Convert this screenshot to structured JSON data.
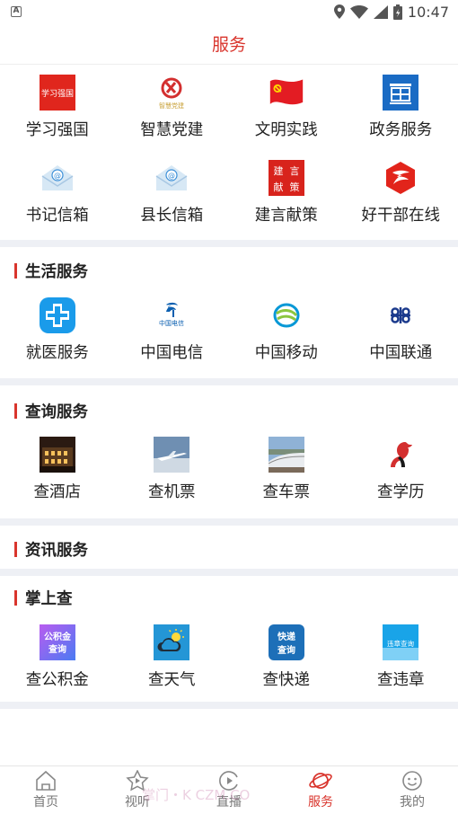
{
  "status_bar": {
    "time": "10:47",
    "left_indicator": "A"
  },
  "header": {
    "title": "服务"
  },
  "top_services": [
    {
      "label": "学习强国",
      "icon": "xuexi-qiangguo-icon"
    },
    {
      "label": "智慧党建",
      "icon": "party-emblem-icon"
    },
    {
      "label": "文明实践",
      "icon": "red-flag-icon"
    },
    {
      "label": "政务服务",
      "icon": "government-icon"
    },
    {
      "label": "书记信箱",
      "icon": "mail-envelope-icon"
    },
    {
      "label": "县长信箱",
      "icon": "mail-envelope-icon"
    },
    {
      "label": "建言献策",
      "icon": "advice-icon"
    },
    {
      "label": "好干部在线",
      "icon": "cadre-online-icon"
    }
  ],
  "icon_text": {
    "xuexi": "学习强国",
    "zhihui": "智慧党建",
    "advice": [
      "建",
      "言",
      "献",
      "策"
    ],
    "telecom": "中国电信",
    "gjj": [
      "公积金",
      "查询"
    ],
    "express": [
      "快递",
      "查询"
    ],
    "violation": "违章查询"
  },
  "sections": [
    {
      "title": "生活服务",
      "items": [
        {
          "label": "就医服务",
          "icon": "medical-cross-icon"
        },
        {
          "label": "中国电信",
          "icon": "china-telecom-icon"
        },
        {
          "label": "中国移动",
          "icon": "china-mobile-icon"
        },
        {
          "label": "中国联通",
          "icon": "china-unicom-icon"
        }
      ]
    },
    {
      "title": "查询服务",
      "items": [
        {
          "label": "查酒店",
          "icon": "hotel-photo-icon"
        },
        {
          "label": "查机票",
          "icon": "airplane-photo-icon"
        },
        {
          "label": "查车票",
          "icon": "train-photo-icon"
        },
        {
          "label": "查学历",
          "icon": "education-icon"
        }
      ]
    },
    {
      "title": "资讯服务",
      "items": []
    },
    {
      "title": "掌上查",
      "items": [
        {
          "label": "查公积金",
          "icon": "housing-fund-icon"
        },
        {
          "label": "查天气",
          "icon": "weather-icon"
        },
        {
          "label": "查快递",
          "icon": "express-icon"
        },
        {
          "label": "查违章",
          "icon": "traffic-violation-icon"
        }
      ]
    }
  ],
  "tabs": [
    {
      "label": "首页",
      "icon": "home-icon",
      "active": false
    },
    {
      "label": "视听",
      "icon": "star-play-icon",
      "active": false
    },
    {
      "label": "直播",
      "icon": "live-icon",
      "active": false
    },
    {
      "label": "服务",
      "icon": "service-planet-icon",
      "active": true
    },
    {
      "label": "我的",
      "icon": "smiley-icon",
      "active": false
    }
  ],
  "watermark": "掌门・K  CZM.CO",
  "colors": {
    "accent": "#d9352d",
    "section_gap": "#eef0f5",
    "text": "#222222"
  }
}
